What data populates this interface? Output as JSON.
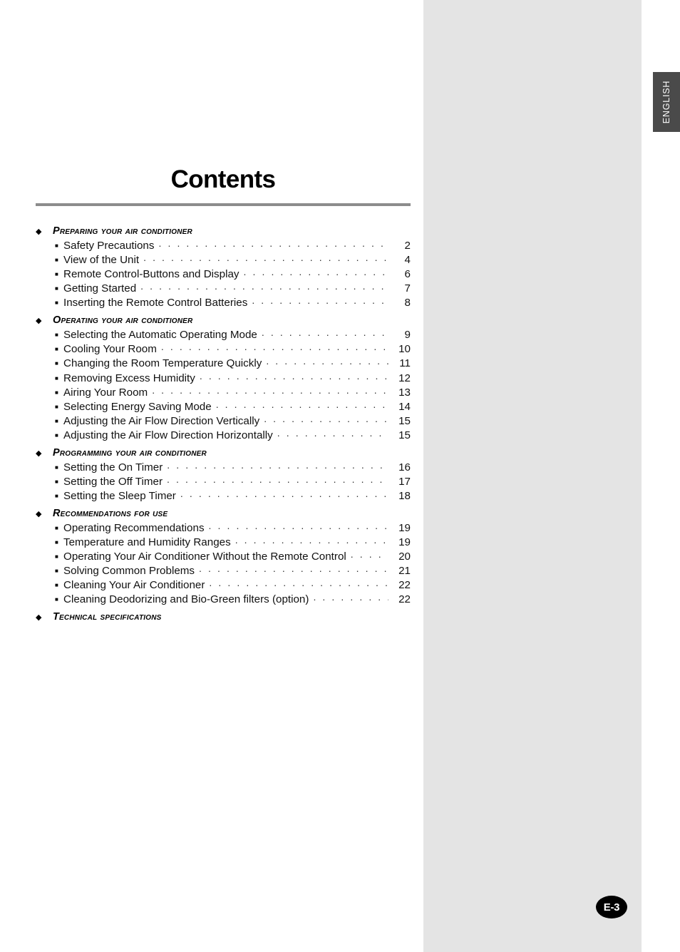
{
  "page": {
    "title": "Contents",
    "language_tab": "ENGLISH",
    "page_badge": "E-3"
  },
  "icons": {
    "section_bullet": "◆",
    "entry_bullet": "■"
  },
  "colors": {
    "panel_gray": "#e4e4e4",
    "tab_dark": "#4a4a4a",
    "rule_gray": "#8c8c8c",
    "text_black": "#000000",
    "badge_black": "#000000"
  },
  "toc": {
    "sections": [
      {
        "title": "Preparing your air conditioner",
        "entries": [
          {
            "label": "Safety Precautions",
            "page": "2"
          },
          {
            "label": "View of the Unit",
            "page": "4"
          },
          {
            "label": "Remote Control-Buttons and Display",
            "page": "6"
          },
          {
            "label": "Getting Started",
            "page": "7"
          },
          {
            "label": "Inserting the Remote Control Batteries",
            "page": "8"
          }
        ]
      },
      {
        "title": "Operating your air conditioner",
        "entries": [
          {
            "label": "Selecting the Automatic Operating Mode",
            "page": "9"
          },
          {
            "label": "Cooling Your Room",
            "page": "10"
          },
          {
            "label": "Changing the Room Temperature Quickly",
            "page": "11"
          },
          {
            "label": "Removing Excess Humidity",
            "page": "12"
          },
          {
            "label": "Airing Your Room",
            "page": "13"
          },
          {
            "label": "Selecting Energy Saving Mode",
            "page": "14"
          },
          {
            "label": "Adjusting the Air Flow Direction Vertically",
            "page": "15"
          },
          {
            "label": "Adjusting the Air Flow Direction Horizontally",
            "page": "15"
          }
        ]
      },
      {
        "title": "Programming your air conditioner",
        "entries": [
          {
            "label": "Setting the On Timer",
            "page": "16"
          },
          {
            "label": "Setting the Off Timer",
            "page": "17"
          },
          {
            "label": "Setting the Sleep Timer",
            "page": "18"
          }
        ]
      },
      {
        "title": "Recommendations for use",
        "entries": [
          {
            "label": "Operating Recommendations",
            "page": "19"
          },
          {
            "label": "Temperature and Humidity Ranges",
            "page": "19"
          },
          {
            "label": "Operating Your Air Conditioner Without the Remote Control",
            "page": "20"
          },
          {
            "label": "Solving Common Problems",
            "page": "21"
          },
          {
            "label": "Cleaning Your Air Conditioner",
            "page": "22"
          },
          {
            "label": "Cleaning Deodorizing and Bio-Green filters (option)",
            "page": "22"
          }
        ]
      },
      {
        "title": "Technical specifications",
        "entries": []
      }
    ]
  }
}
